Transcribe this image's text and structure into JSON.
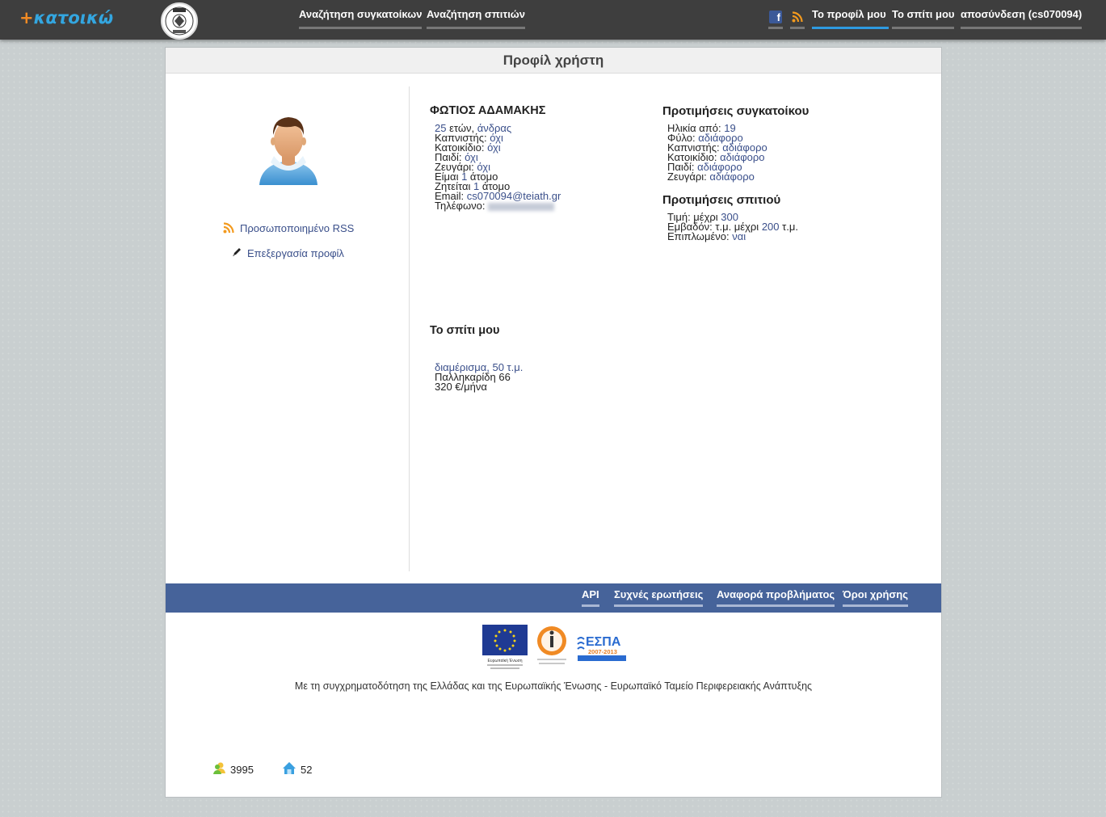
{
  "header": {
    "logo_plus": "+",
    "logo_text": "κατοικώ",
    "seal_text": "ΤΕΙ\nΑΘΗΝΑΣ",
    "nav": [
      {
        "label": "Αναζήτηση συγκατοίκων"
      },
      {
        "label": "Αναζήτηση σπιτιών"
      },
      {
        "label": "Το προφίλ μου"
      },
      {
        "label": "Το σπίτι μου"
      },
      {
        "label": "αποσύνδεση (cs070094)"
      }
    ]
  },
  "page": {
    "title": "Προφίλ χρήστη"
  },
  "sidebar": {
    "rss_label": "Προσωποποιημένο RSS",
    "edit_label": "Επεξεργασία προφίλ"
  },
  "profile": {
    "name": "ΦΩΤΙΟΣ ΑΔΑΜΑΚΗΣ",
    "age": "25",
    "age_suffix": " ετών, ",
    "gender": "άνδρας",
    "smoker_label": "Καπνιστής: ",
    "smoker": "όχι",
    "pet_label": "Κατοικίδιο: ",
    "pet": "όχι",
    "child_label": "Παιδί: ",
    "child": "όχι",
    "couple_label": "Ζευγάρι: ",
    "couple": "όχι",
    "iam_label": "Είμαι ",
    "iam": "1",
    "iam_suffix": " άτομο",
    "wanted_label": "Ζητείται ",
    "wanted": "1",
    "wanted_suffix": " άτομο",
    "email_label": "Email: ",
    "email": "cs070094@teiath.gr",
    "phone_label": "Τηλέφωνο: "
  },
  "roommate_prefs": {
    "title": "Προτιμήσεις συγκατοίκου",
    "age_label": "Ηλικία από: ",
    "age": "19",
    "gender_label": "Φύλο: ",
    "gender": "αδιάφορο",
    "smoker_label": "Καπνιστής: ",
    "smoker": "αδιάφορο",
    "pet_label": "Κατοικίδιο: ",
    "pet": "αδιάφορο",
    "child_label": "Παιδί: ",
    "child": "αδιάφορο",
    "couple_label": "Ζευγάρι: ",
    "couple": "αδιάφορο"
  },
  "house_prefs": {
    "title": "Προτιμήσεις σπιτιού",
    "price_label": "Τιμή: μέχρι ",
    "price": "300",
    "area_label": "Εμβαδόν: τ.μ. μέχρι ",
    "area": "200",
    "area_suffix": " τ.μ.",
    "furnished_label": "Επιπλωμένο: ",
    "furnished": "ναι"
  },
  "my_house": {
    "title": "Το σπίτι μου",
    "type": "διαμέρισμα, 50 τ.μ.",
    "address": "Παλληκαρίδη 66",
    "rent": "320 €/μήνα"
  },
  "footer": {
    "links": [
      {
        "label": "API"
      },
      {
        "label": "Συχνές ερωτήσεις"
      },
      {
        "label": "Αναφορά προβλήματος"
      },
      {
        "label": "Όροι χρήσης"
      }
    ],
    "eu_caption": "Ευρωπαϊκή Ένωση",
    "espa_text": "ΕΣΠΑ",
    "espa_years": "2007-2013",
    "funding_text": "Με τη συγχρηματοδότηση της Ελλάδας και της Ευρωπαϊκής Ένωσης - Ευρωπαϊκό Ταμείο Περιφερειακής Ανάπτυξης",
    "users_count": "3995",
    "houses_count": "52"
  }
}
